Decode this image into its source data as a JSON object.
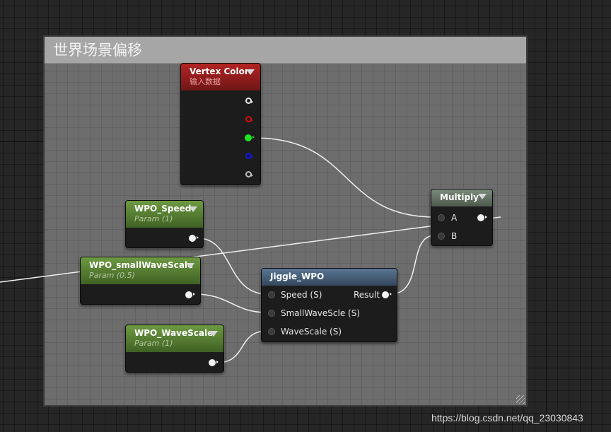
{
  "comment_box": {
    "title": "世界场景偏移"
  },
  "nodes": {
    "vertex_color": {
      "title": "Vertex Color",
      "subtitle": "输入数据"
    },
    "wpo_speed": {
      "title": "WPO_Speed",
      "subtitle": "Param (1)"
    },
    "wpo_small_wave_scale": {
      "title": "WPO_smallWaveScale",
      "subtitle": "Param (0.5)"
    },
    "wpo_wave_scale": {
      "title": "WPO_WaveScale",
      "subtitle": "Param (1)"
    },
    "jiggle_wpo": {
      "title": "Jiggle_WPO",
      "inputs": [
        "Speed (S)",
        "SmallWaveScle (S)",
        "WaveScale (S)"
      ],
      "output": "Result"
    },
    "multiply": {
      "title": "Multiply",
      "inputs": [
        "A",
        "B"
      ]
    }
  },
  "colors": {
    "background": "#262626",
    "comment_body": "#6d6d6d",
    "comment_title_bar": "#a6a6a6",
    "vertex_color_header": "#b42323",
    "param_header": "#6d9a42",
    "function_header": "#5a7693",
    "math_header": "#7a8a7a",
    "wire": "#f0f0f0"
  },
  "icons": [
    "collapse-arrow-icon",
    "output-pin-icon",
    "input-pin-icon",
    "resize-grip-icon"
  ],
  "watermark": "https://blog.csdn.net/qq_23030843"
}
